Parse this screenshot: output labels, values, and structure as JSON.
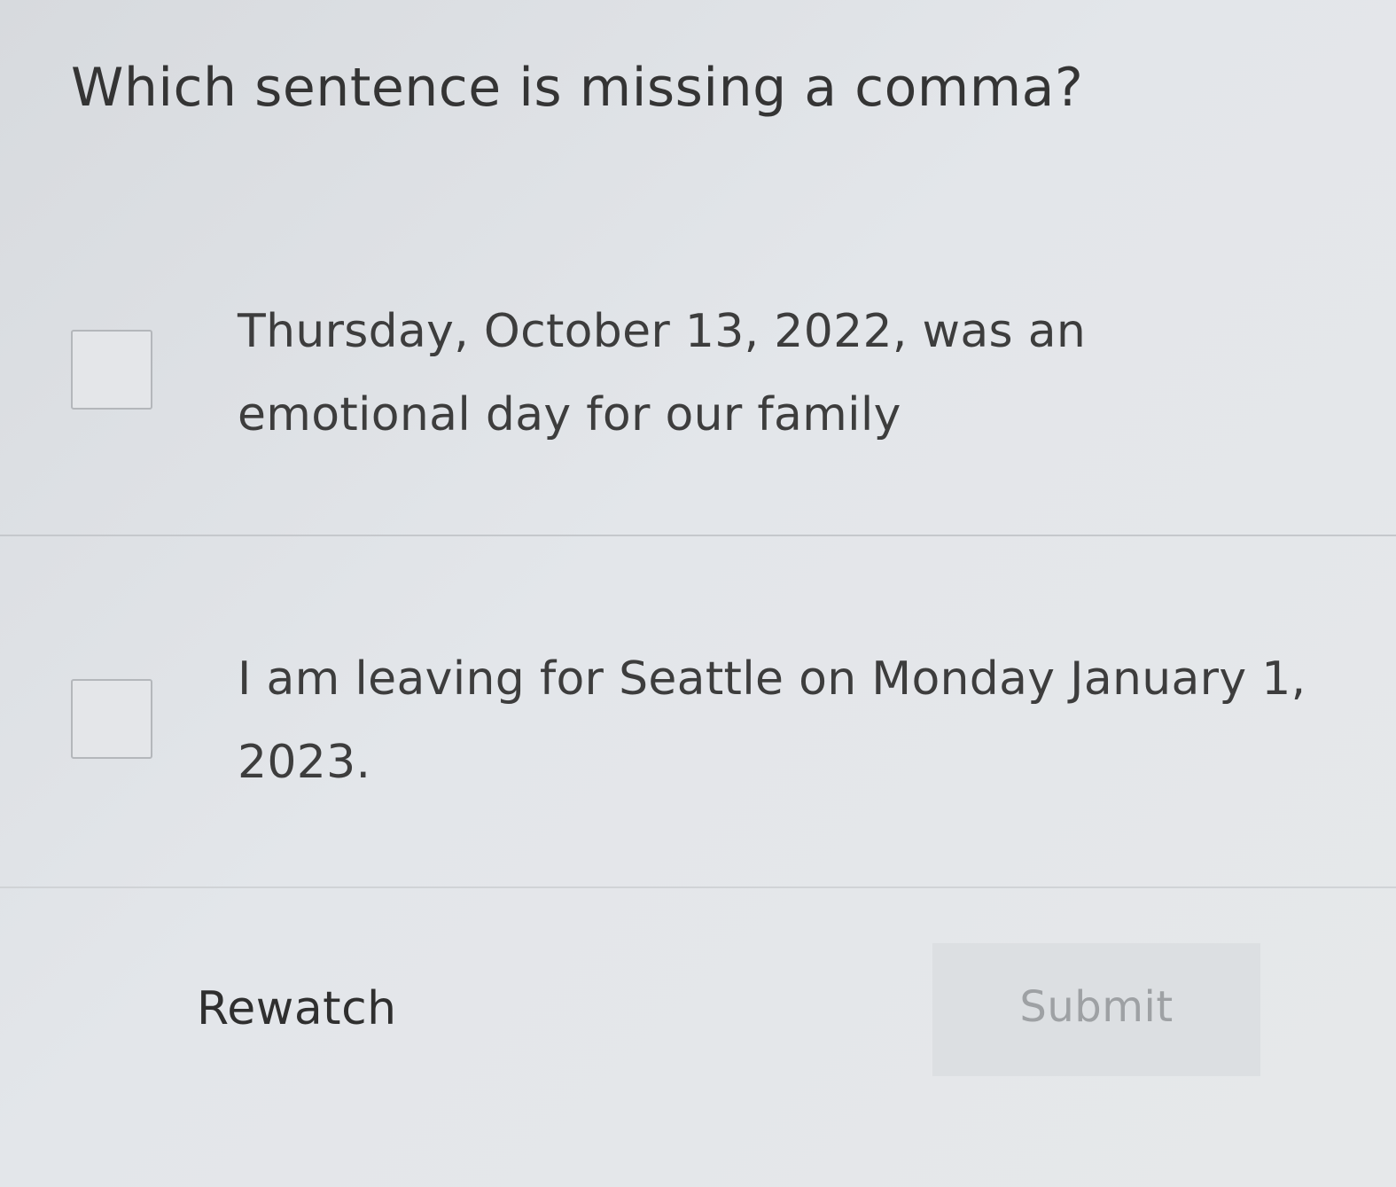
{
  "question": {
    "text": "Which sentence is missing a comma?"
  },
  "options": [
    {
      "text": "Thursday, October 13, 2022, was an emotional day for our family",
      "checked": false
    },
    {
      "text": "I am leaving for Seattle on Monday January 1, 2023.",
      "checked": false
    }
  ],
  "actions": {
    "rewatch_label": "Rewatch",
    "submit_label": "Submit",
    "submit_enabled": false
  },
  "colors": {
    "background": "#dfe2e6",
    "text": "#3a3a3a",
    "submit_disabled_text": "#9ea1a4"
  }
}
